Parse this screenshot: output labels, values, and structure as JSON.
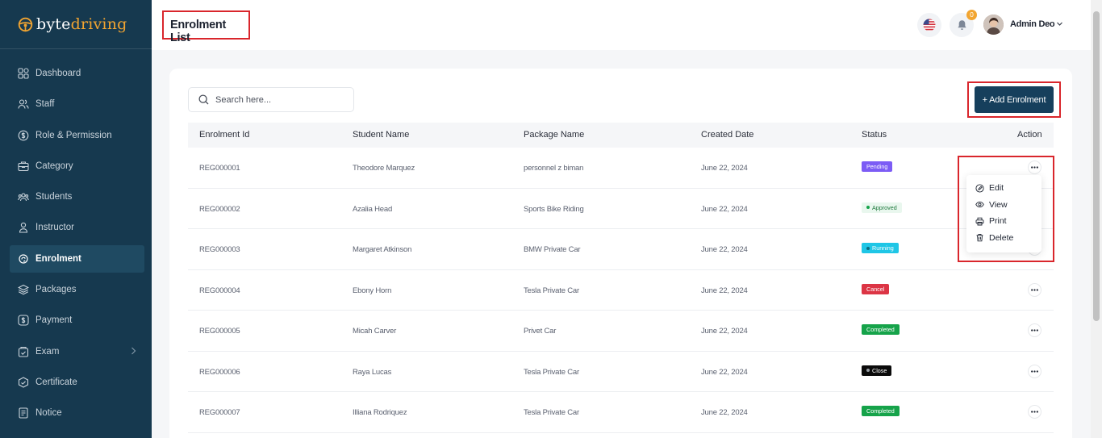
{
  "brand": {
    "name_part1": "byte",
    "name_part2": "driving",
    "accent": "#f1a431"
  },
  "sidebar": {
    "items": [
      {
        "label": "Dashboard",
        "icon": "dashboard-icon"
      },
      {
        "label": "Staff",
        "icon": "users-icon"
      },
      {
        "label": "Role & Permission",
        "icon": "dollar-icon"
      },
      {
        "label": "Category",
        "icon": "briefcase-icon"
      },
      {
        "label": "Students",
        "icon": "students-icon"
      },
      {
        "label": "Instructor",
        "icon": "user-icon"
      },
      {
        "label": "Enrolment",
        "icon": "enrolment-icon",
        "active": true
      },
      {
        "label": "Packages",
        "icon": "layers-icon"
      },
      {
        "label": "Payment",
        "icon": "dollar-circle-icon"
      },
      {
        "label": "Exam",
        "icon": "exam-icon",
        "has_children": true
      },
      {
        "label": "Certificate",
        "icon": "certificate-icon"
      },
      {
        "label": "Notice",
        "icon": "notice-icon"
      }
    ]
  },
  "header": {
    "title": "Enrolment List",
    "notification_count": "0",
    "user_name": "Admin Deo"
  },
  "search": {
    "placeholder": "Search here..."
  },
  "toolbar": {
    "add_label": "+ Add Enrolment"
  },
  "table": {
    "columns": [
      "Enrolment Id",
      "Student Name",
      "Package Name",
      "Created Date",
      "Status",
      "Action"
    ],
    "rows": [
      {
        "id": "REG000001",
        "student": "Theodore Marquez",
        "package": "personnel z biman",
        "date": "June 22, 2024",
        "status": "Pending",
        "status_color": "#7c5cf5",
        "dot": false
      },
      {
        "id": "REG000002",
        "student": "Azalia Head",
        "package": "Sports Bike Riding",
        "date": "June 22, 2024",
        "status": "Approved",
        "status_color": "#e9f7ee",
        "dot": true
      },
      {
        "id": "REG000003",
        "student": "Margaret Atkinson",
        "package": "BMW Private Car",
        "date": "June 22, 2024",
        "status": "Running",
        "status_color": "#1fc6e6",
        "dot": true
      },
      {
        "id": "REG000004",
        "student": "Ebony Horn",
        "package": "Tesla Private Car",
        "date": "June 22, 2024",
        "status": "Cancel",
        "status_color": "#dc3545",
        "dot": false
      },
      {
        "id": "REG000005",
        "student": "Micah Carver",
        "package": "Privet Car",
        "date": "June 22, 2024",
        "status": "Completed",
        "status_color": "#16a34a",
        "dot": false
      },
      {
        "id": "REG000006",
        "student": "Raya Lucas",
        "package": "Tesla Private Car",
        "date": "June 22, 2024",
        "status": "Close",
        "status_color": "#0b0b0b",
        "dot": true
      },
      {
        "id": "REG000007",
        "student": "Illiana Rodriquez",
        "package": "Tesla Private Car",
        "date": "June 22, 2024",
        "status": "Completed",
        "status_color": "#16a34a",
        "dot": false
      }
    ]
  },
  "action_menu": {
    "items": [
      {
        "label": "Edit",
        "icon": "edit-icon"
      },
      {
        "label": "View",
        "icon": "eye-icon"
      },
      {
        "label": "Print",
        "icon": "printer-icon"
      },
      {
        "label": "Delete",
        "icon": "trash-icon"
      }
    ]
  }
}
